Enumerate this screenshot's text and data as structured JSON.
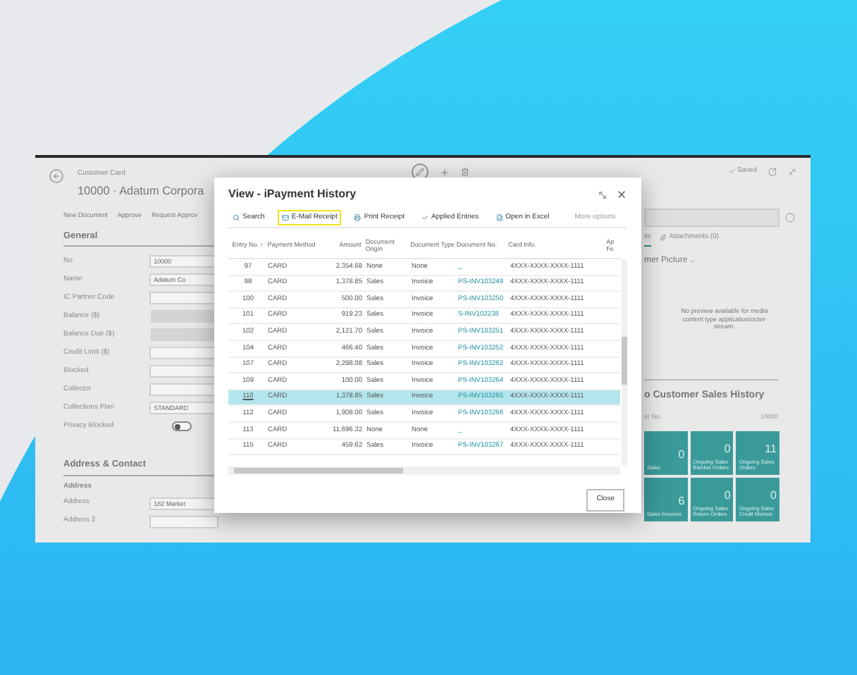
{
  "app": {
    "breadcrumb": "Customer Card",
    "title": "10000 · Adatum Corpora",
    "saved": "Saved",
    "actions": [
      "New Document",
      "Approve",
      "Request Approv"
    ],
    "general": {
      "heading": "General",
      "fields": [
        {
          "label": "No.",
          "kind": "text",
          "value": "10000"
        },
        {
          "label": "Name",
          "kind": "text",
          "value": "Adatum Co"
        },
        {
          "label": "IC Partner Code",
          "kind": "text"
        },
        {
          "label": "Balance ($)",
          "kind": "shaded"
        },
        {
          "label": "Balance Due ($)",
          "kind": "shaded"
        },
        {
          "label": "Credit Limit ($)",
          "kind": "text"
        },
        {
          "label": "Blocked",
          "kind": "text"
        },
        {
          "label": "Collector",
          "kind": "text"
        },
        {
          "label": "Collections Plan",
          "kind": "text",
          "value": "STANDARD"
        },
        {
          "label": "Privacy Blocked",
          "kind": "toggle",
          "on": false
        }
      ]
    },
    "address": {
      "heading": "Address & Contact",
      "subheading": "Address",
      "fields": [
        {
          "label": "Address",
          "value": "182 Market"
        },
        {
          "label": "Address 2"
        }
      ]
    },
    "factbox": {
      "tabs": [
        {
          "label": "ils",
          "selected": true
        },
        {
          "label": "Attachments (0)",
          "selected": false
        }
      ],
      "picture_title": "mer Picture",
      "picture_note": "No preview available for media content type application/octet-stream.",
      "history_title": "o Customer Sales History",
      "history_subtitle": "er No.",
      "history_number": "10000",
      "tiles": [
        {
          "value": "0",
          "label": "Sales"
        },
        {
          "value": "0",
          "label": "Ongoing Sales Blanket Orders"
        },
        {
          "value": "11",
          "label": "Ongoing Sales Orders"
        },
        {
          "value": "6",
          "label": "Sales Invoices"
        },
        {
          "value": "0",
          "label": "Ongoing Sales Return Orders"
        },
        {
          "value": "0",
          "label": "Ongoing Sales Credit Memos"
        }
      ]
    }
  },
  "dialog": {
    "title": "View - iPayment History",
    "toolbar": [
      {
        "kind": "search",
        "label": "Search",
        "highlighted": false
      },
      {
        "kind": "mail",
        "label": "E-Mail Receipt",
        "highlighted": true
      },
      {
        "kind": "print",
        "label": "Print Receipt",
        "highlighted": false
      },
      {
        "kind": "check",
        "label": "Applied Entries",
        "highlighted": false
      },
      {
        "kind": "excel",
        "label": "Open in Excel",
        "highlighted": false
      },
      {
        "kind": "more",
        "label": "More options",
        "highlighted": false
      }
    ],
    "columns": [
      "Entry No. ↑",
      "Payment Method",
      "Amount",
      "Document Origin",
      "Document Type",
      "Document No.",
      "Card Info.",
      "Ap Fe"
    ],
    "rows": [
      {
        "entry": "97",
        "method": "CARD",
        "amount": "2,354.68",
        "origin": "None",
        "type": "None",
        "doc": "_",
        "card": "4XXX-XXXX-XXXX-1111",
        "selected": false
      },
      {
        "entry": "98",
        "method": "CARD",
        "amount": "1,378.85",
        "origin": "Sales",
        "type": "Invoice",
        "doc": "PS-INV103249",
        "card": "4XXX-XXXX-XXXX-1111",
        "selected": false
      },
      {
        "entry": "100",
        "method": "CARD",
        "amount": "500.00",
        "origin": "Sales",
        "type": "Invoice",
        "doc": "PS-INV103250",
        "card": "4XXX-XXXX-XXXX-1111",
        "selected": false
      },
      {
        "entry": "101",
        "method": "CARD",
        "amount": "919.23",
        "origin": "Sales",
        "type": "Invoice",
        "doc": "S-INV102238",
        "card": "4XXX-XXXX-XXXX-1111",
        "selected": false
      },
      {
        "entry": "102",
        "method": "CARD",
        "amount": "2,121.70",
        "origin": "Sales",
        "type": "Invoice",
        "doc": "PS-INV103251",
        "card": "4XXX-XXXX-XXXX-1111",
        "selected": false
      },
      {
        "entry": "104",
        "method": "CARD",
        "amount": "466.40",
        "origin": "Sales",
        "type": "Invoice",
        "doc": "PS-INV103252",
        "card": "4XXX-XXXX-XXXX-1111",
        "selected": false
      },
      {
        "entry": "107",
        "method": "CARD",
        "amount": "2,298.08",
        "origin": "Sales",
        "type": "Invoice",
        "doc": "PS-INV103262",
        "card": "4XXX-XXXX-XXXX-1111",
        "selected": false
      },
      {
        "entry": "109",
        "method": "CARD",
        "amount": "100.00",
        "origin": "Sales",
        "type": "Invoice",
        "doc": "PS-INV103264",
        "card": "4XXX-XXXX-XXXX-1111",
        "selected": false
      },
      {
        "entry": "110",
        "method": "CARD",
        "amount": "1,378.85",
        "origin": "Sales",
        "type": "Invoice",
        "doc": "PS-INV103265",
        "card": "4XXX-XXXX-XXXX-1111",
        "selected": true
      },
      {
        "entry": "112",
        "method": "CARD",
        "amount": "1,908.00",
        "origin": "Sales",
        "type": "Invoice",
        "doc": "PS-INV103266",
        "card": "4XXX-XXXX-XXXX-1111",
        "selected": false
      },
      {
        "entry": "113",
        "method": "CARD",
        "amount": "11,696.32",
        "origin": "None",
        "type": "None",
        "doc": "_",
        "card": "4XXX-XXXX-XXXX-1111",
        "selected": false
      },
      {
        "entry": "115",
        "method": "CARD",
        "amount": "459.62",
        "origin": "Sales",
        "type": "Invoice",
        "doc": "PS-INV103267",
        "card": "4XXX-XXXX-XXXX-1111",
        "selected": false
      }
    ],
    "close": "Close"
  }
}
